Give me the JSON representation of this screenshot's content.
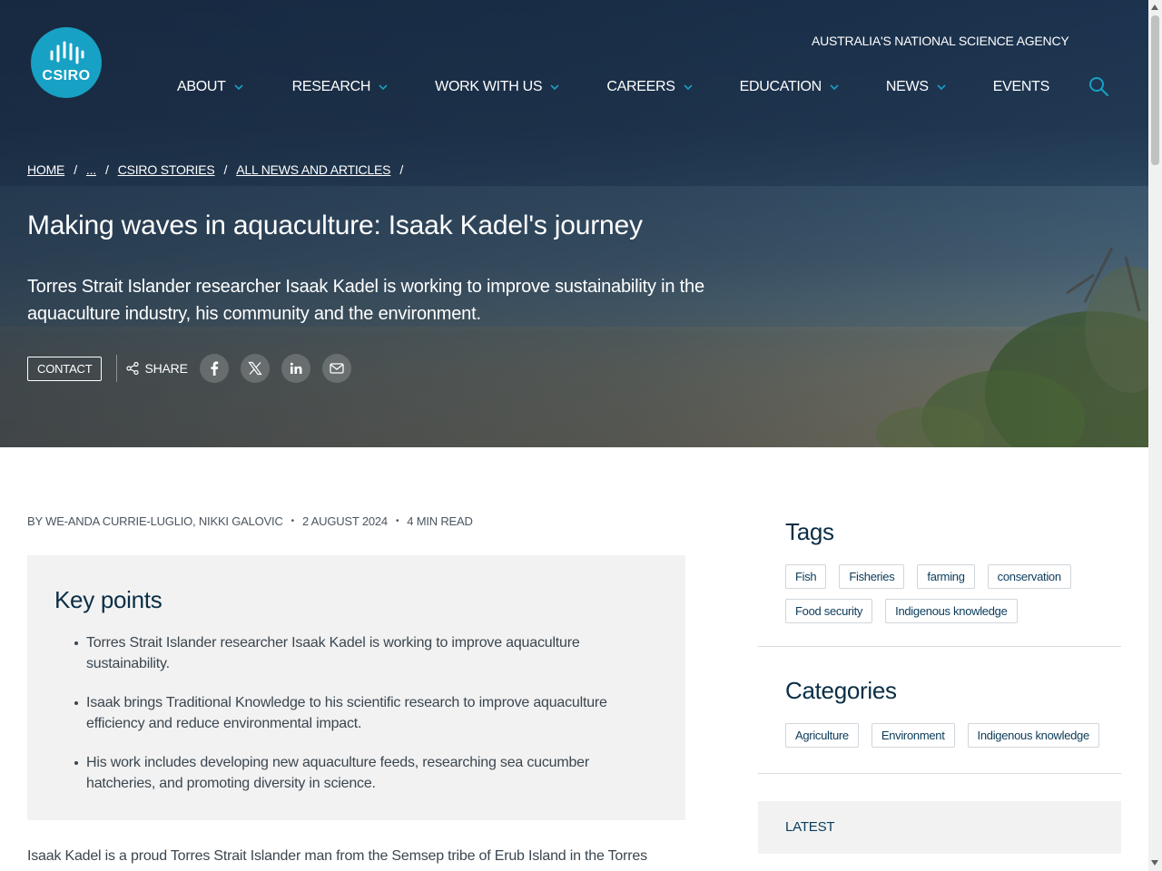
{
  "header": {
    "logo_text": "CSIRO",
    "agency": "AUSTRALIA'S NATIONAL SCIENCE AGENCY",
    "nav": [
      {
        "label": "ABOUT",
        "dropdown": true
      },
      {
        "label": "RESEARCH",
        "dropdown": true
      },
      {
        "label": "WORK WITH US",
        "dropdown": true
      },
      {
        "label": "CAREERS",
        "dropdown": true
      },
      {
        "label": "EDUCATION",
        "dropdown": true
      },
      {
        "label": "NEWS",
        "dropdown": true
      },
      {
        "label": "EVENTS",
        "dropdown": false
      }
    ],
    "search_icon": "search-icon"
  },
  "breadcrumb": [
    "HOME",
    "...",
    "CSIRO STORIES",
    "ALL NEWS AND ARTICLES"
  ],
  "hero": {
    "title": "Making waves in aquaculture: Isaak Kadel's journey",
    "subtitle": "Torres Strait Islander researcher Isaak Kadel is working to improve sustainability in the aquaculture industry, his community and the environment.",
    "contact_label": "CONTACT",
    "share_label": "SHARE",
    "social_icons": [
      "facebook-icon",
      "x-icon",
      "linkedin-icon",
      "email-icon"
    ]
  },
  "byline": {
    "authors": "BY WE-ANDA CURRIE-LUGLIO, NIKKI GALOVIC",
    "date": "2 AUGUST 2024",
    "read_time": "4 MIN READ"
  },
  "key_points": {
    "heading": "Key points",
    "items": [
      "Torres Strait Islander researcher Isaak Kadel is working to improve aquaculture sustainability.",
      "Isaak brings Traditional Knowledge to his scientific research to improve aquaculture efficiency and reduce environmental impact.",
      "His work includes developing new aquaculture feeds, researching sea cucumber hatcheries, and promoting diversity in science."
    ]
  },
  "body_text": "Isaak Kadel is a proud Torres Strait Islander man from the Semsep tribe of Erub Island in the Torres",
  "sidebar": {
    "tags_heading": "Tags",
    "tags": [
      "Fish",
      "Fisheries",
      "farming",
      "conservation",
      "Food security",
      "Indigenous knowledge"
    ],
    "categories_heading": "Categories",
    "categories": [
      "Agriculture",
      "Environment",
      "Indigenous knowledge"
    ],
    "latest_label": "LATEST"
  },
  "colors": {
    "brand": "#17a1c4",
    "heading": "#0b2e46",
    "panel": "#f2f2f2"
  }
}
